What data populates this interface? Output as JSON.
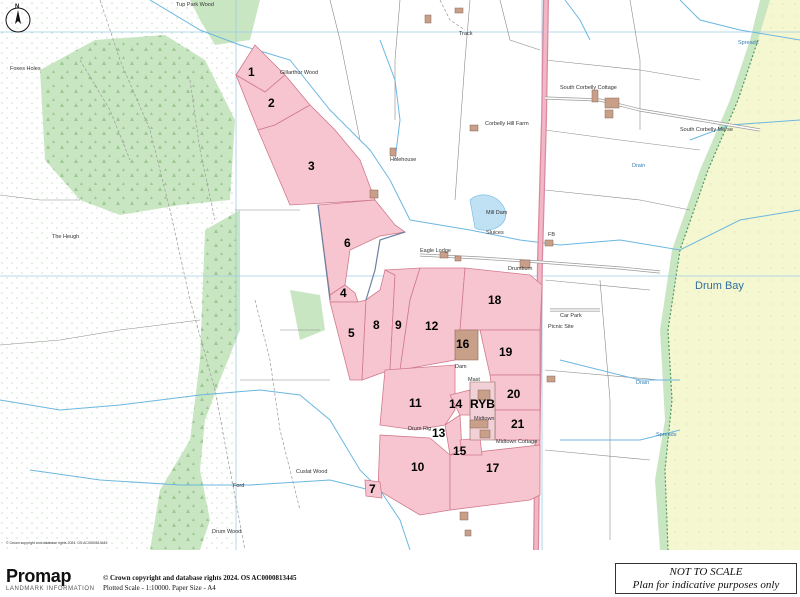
{
  "map": {
    "lots": [
      {
        "num": "1"
      },
      {
        "num": "2"
      },
      {
        "num": "3"
      },
      {
        "num": "4"
      },
      {
        "num": "5"
      },
      {
        "num": "6"
      },
      {
        "num": "7"
      },
      {
        "num": "8"
      },
      {
        "num": "9"
      },
      {
        "num": "10"
      },
      {
        "num": "11"
      },
      {
        "num": "12"
      },
      {
        "num": "13"
      },
      {
        "num": "14"
      },
      {
        "num": "15"
      },
      {
        "num": "16"
      },
      {
        "num": "17"
      },
      {
        "num": "18"
      },
      {
        "num": "19"
      },
      {
        "num": "20"
      },
      {
        "num": "21"
      }
    ],
    "ryb_label": "RYB",
    "labels": {
      "tup_park_wood": "Tup Park Wood",
      "foxes_holes": "Foxes Holes",
      "the_heugh": "The Heugh",
      "gillarthur_wood": "Gillarthur Wood",
      "holehouse": "Holehouse",
      "corbelly_hill_farm": "Corbelly Hill Farm",
      "south_corbelly_cottage": "South Corbelly Cottage",
      "south_corbelly_merse": "South Corbelly Merse",
      "mill_dam": "Mill Dam",
      "sluices": "Sluices",
      "eagle_lodge": "Eagle Lodge",
      "drumburn": "Drumburn",
      "drum_bay": "Drum Bay",
      "car_park": "Car Park",
      "picnic_site": "Picnic Site",
      "drum_rig": "Drum Rig",
      "midtown": "Midtown",
      "midtown_cottage": "Midtown Cottage",
      "cuslat_wood": "Cuslat Wood",
      "drum_wood": "Drum Wood",
      "track": "Track",
      "ford": "Ford",
      "spreads": "Spreads",
      "drain": "Drain",
      "mast": "Mast",
      "fb": "FB",
      "dam": "Dam"
    },
    "map_copyright": "© Crown copyright and database rights 2024. OS AC0000813445",
    "colors": {
      "lot_fill": "#f7c5d0",
      "lot_stroke": "#d07a8c",
      "woodland": "#c9e6c2",
      "shore": "#f5f7d0",
      "road": "#e8a6b4",
      "water": "#6cb7e0",
      "grid": "#9ccbe6",
      "building": "#c8a08a"
    }
  },
  "footer": {
    "brand": "Promap",
    "brand_sub": "LANDMARK INFORMATION",
    "copyright": "© Crown copyright and database rights 2024. OS AC0000813445",
    "scale_line": "Plotted Scale - 1:10000. Paper Size - A4",
    "notice_line1": "NOT TO SCALE",
    "notice_line2": "Plan for indicative purposes only"
  }
}
